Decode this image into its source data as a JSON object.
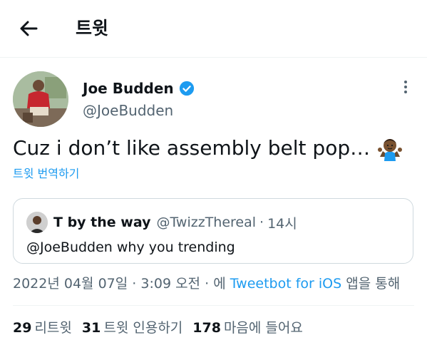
{
  "header": {
    "title": "트윗"
  },
  "tweet": {
    "display_name": "Joe Budden",
    "handle": "@JoeBudden",
    "text": "Cuz i don’t like assembly belt pop…",
    "translate_label": "트윗 번역하기",
    "date": "2022년 04월 07일",
    "time": "3:09 오전",
    "via_prefix": "에",
    "source": "Tweetbot for iOS",
    "via_suffix": "앱을 통해"
  },
  "quote": {
    "display_name": "T by the way",
    "handle": "@TwizzThereal",
    "time": "14시",
    "text": "@JoeBudden why you trending"
  },
  "stats": [
    {
      "count": "29",
      "label": "리트윗"
    },
    {
      "count": "31",
      "label": "트윗 인용하기"
    },
    {
      "count": "178",
      "label": "마음에 들어요"
    }
  ],
  "colors": {
    "accent": "#1d9bf0",
    "secondary_text": "#536471",
    "border": "#cfd9de"
  }
}
